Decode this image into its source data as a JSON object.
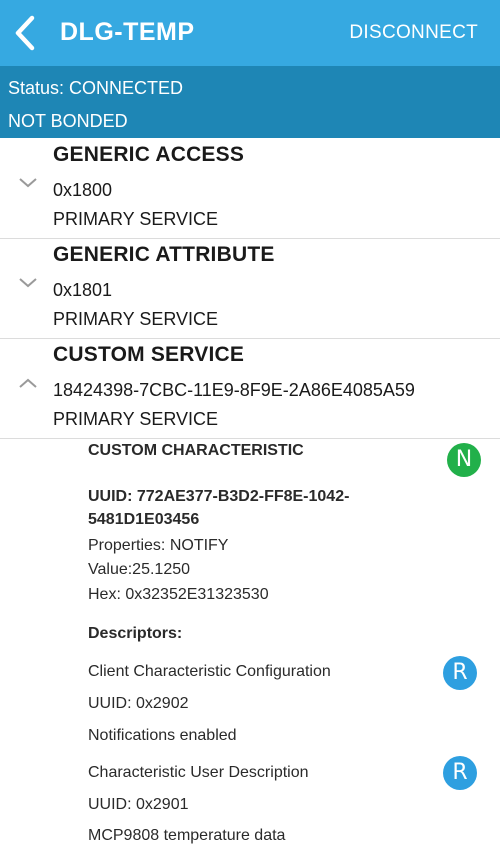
{
  "header": {
    "title": "DLG-TEMP",
    "disconnect_label": "DISCONNECT",
    "accent_color": "#36a9e1",
    "back_icon": "chevron-left-icon"
  },
  "status": {
    "connection": "Status: CONNECTED",
    "bonding": "NOT BONDED",
    "bar_color": "#1e86b5"
  },
  "services": [
    {
      "name": "GENERIC ACCESS",
      "uuid": "0x1800",
      "type": "PRIMARY SERVICE",
      "expanded": false
    },
    {
      "name": "GENERIC ATTRIBUTE",
      "uuid": "0x1801",
      "type": "PRIMARY SERVICE",
      "expanded": false
    },
    {
      "name": "CUSTOM SERVICE",
      "uuid": "18424398-7CBC-11E9-8F9E-2A86E4085A59",
      "type": "PRIMARY SERVICE",
      "expanded": true
    }
  ],
  "characteristic": {
    "name": "CUSTOM CHARACTERISTIC",
    "badge": "N",
    "uuid_line1": "UUID: 772AE377-B3D2-FF8E-1042-",
    "uuid_line2": "5481D1E03456",
    "properties": "Properties: NOTIFY",
    "value": "Value:25.1250",
    "hex": "Hex: 0x32352E31323530",
    "descriptors_label": "Descriptors:",
    "descriptors": [
      {
        "name": "Client Characteristic Configuration",
        "uuid": "UUID: 0x2902",
        "value": "Notifications enabled",
        "badge": "R"
      },
      {
        "name": "Characteristic User Description",
        "uuid": "UUID: 0x2901",
        "value": "MCP9808 temperature data",
        "badge": "R"
      }
    ]
  }
}
